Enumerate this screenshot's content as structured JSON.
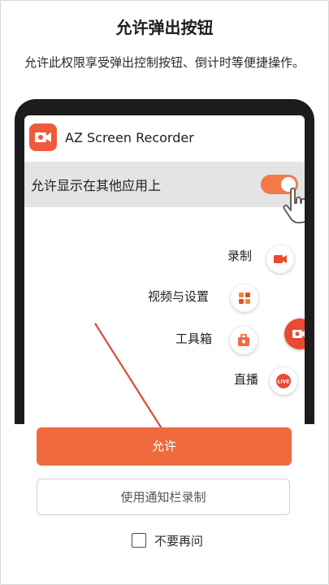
{
  "dialog": {
    "title": "允许弹出按钮",
    "subtitle": "允许此权限享受弹出控制按钮、倒计时等便捷操作。"
  },
  "mockup": {
    "app_name": "AZ Screen Recorder",
    "permission_label": "允许显示在其他应用上",
    "toggle_on": true,
    "menu": [
      {
        "label": "录制",
        "icon": "camcorder-icon"
      },
      {
        "label": "视频与设置",
        "icon": "grid-icon"
      },
      {
        "label": "工具箱",
        "icon": "toolbox-icon"
      },
      {
        "label": "直播",
        "icon": "live-icon",
        "badge": "LIVE"
      }
    ],
    "fab_icon": "camcorder-icon"
  },
  "actions": {
    "allow_label": "允许",
    "notification_label": "使用通知栏录制",
    "dont_ask_label": "不要再问",
    "dont_ask_checked": false
  },
  "colors": {
    "accent": "#f06a3d",
    "brand_red": "#e94a34"
  }
}
